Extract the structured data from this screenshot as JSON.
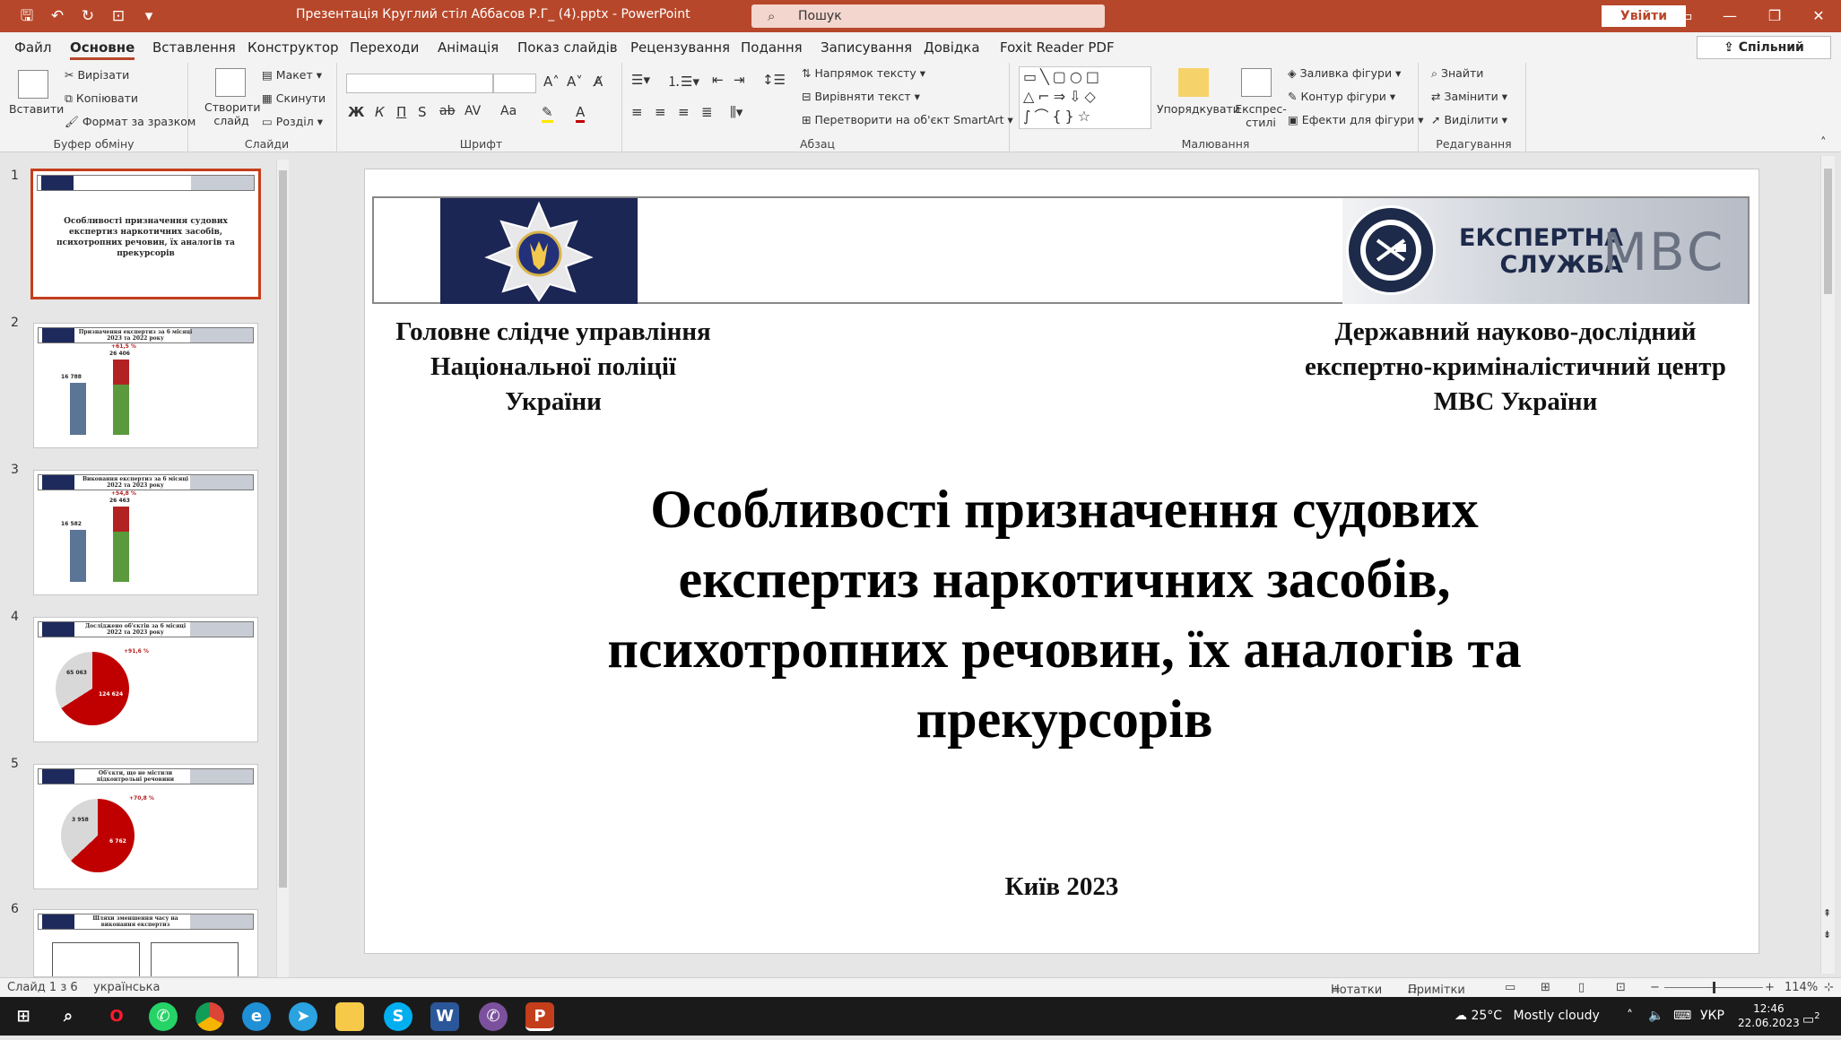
{
  "titlebar": {
    "quick_access": [
      "save-icon",
      "undo-icon",
      "redo-icon",
      "present-icon",
      "customize-icon"
    ],
    "doc_title": "Презентація Круглий стіл Аббасов Р.Г_ (4).pptx  -  PowerPoint",
    "search_placeholder": "Пошук",
    "signin_label": "Увійти",
    "controls": [
      "ribbon-display",
      "minimize",
      "restore",
      "close"
    ]
  },
  "menu": {
    "items": [
      "Файл",
      "Основне",
      "Вставлення",
      "Конструктор",
      "Переходи",
      "Анімація",
      "Показ слайдів",
      "Рецензування",
      "Подання",
      "Записування",
      "Довідка",
      "Foxit Reader PDF"
    ],
    "active": "Основне",
    "share_label": "Спільний доступ"
  },
  "ribbon": {
    "clipboard": {
      "label": "Буфер обміну",
      "paste": "Вставити",
      "cut": "Вирізати",
      "copy": "Копіювати",
      "format_painter": "Формат за зразком"
    },
    "slides": {
      "label": "Слайди",
      "new_slide": "Створити слайд",
      "layout": "Макет",
      "reset": "Скинути",
      "section": "Розділ"
    },
    "font": {
      "label": "Шрифт",
      "bold": "Ж",
      "italic": "К",
      "underline": "П",
      "shadow": "S",
      "strike": "ab",
      "spacing": "AV",
      "case": "Aa"
    },
    "paragraph": {
      "label": "Абзац",
      "text_direction": "Напрямок тексту",
      "align_text": "Вирівняти текст",
      "smartart": "Перетворити на об'єкт SmartArt"
    },
    "drawing": {
      "label": "Малювання",
      "arrange": "Упорядкувати",
      "quick_styles": "Експрес-стилі",
      "fill": "Заливка фігури",
      "outline": "Контур фігури",
      "effects": "Ефекти для фігури"
    },
    "editing": {
      "label": "Редагування",
      "find": "Знайти",
      "replace": "Замінити",
      "select": "Виділити"
    }
  },
  "thumbnails": [
    {
      "num": "1",
      "title": "Особливості призначення судових експертиз наркотичних засобів, психотропних речовин, їх аналогів та прекурсорів"
    },
    {
      "num": "2",
      "title": "Призначення експертиз за 6 місяці 2023 та 2022 року",
      "big": "26 406",
      "small": "16 788",
      "pct": "+61,5 %"
    },
    {
      "num": "3",
      "title": "Виконання експертиз за 6 місяці 2022 та 2023 року",
      "big": "26 463",
      "small": "16 582",
      "pct": "+54,8 %"
    },
    {
      "num": "4",
      "title": "Досліджено об'єктів за 6 місяці 2022 та 2023 року",
      "a": "65 063",
      "b": "124 624",
      "pct": "+91,6 %"
    },
    {
      "num": "5",
      "title": "Об'єкти, що не містили підконтрольні речовини",
      "a": "3 958",
      "b": "6 762",
      "pct": "+70,8 %"
    },
    {
      "num": "6",
      "title": "Шляхи зменшення часу на виконання експертиз"
    }
  ],
  "slide": {
    "left_org": [
      "Головне слідче управління",
      "Національної поліції",
      "України"
    ],
    "right_org": [
      "Державний науково-дослідний",
      "експертно-криміналістичний центр",
      "МВС України"
    ],
    "mvs_line1": "ЕКСПЕРТНА",
    "mvs_line2": "СЛУЖБА",
    "mvs_big": "МВС",
    "title_lines": [
      "Особливості призначення судових",
      "експертиз наркотичних засобів,",
      "психотропних речовин, їх аналогів та",
      "прекурсорів"
    ],
    "city": "Київ 2023"
  },
  "status": {
    "slide_info": "Слайд 1 з 6",
    "language": "українська",
    "notes": "Нотатки",
    "comments": "Примітки",
    "zoom": "114%"
  },
  "taskbar": {
    "weather_temp": "25°C",
    "weather_desc": "Mostly cloudy",
    "lang": "УКР",
    "time": "12:46",
    "date": "22.06.2023",
    "notif_count": "2"
  },
  "colors": {
    "accent": "#b7472a",
    "navy": "#1c2654",
    "bar_blue": "#5a7596",
    "bar_red": "#b22222",
    "bar_green": "#5a9a3c"
  }
}
